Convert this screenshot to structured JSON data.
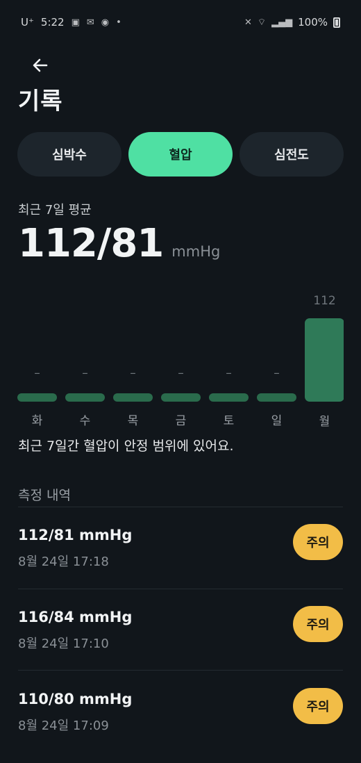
{
  "status_bar": {
    "carrier": "U⁺",
    "time": "5:22",
    "battery": "100%"
  },
  "header": {
    "title": "기록"
  },
  "tabs": [
    {
      "label": "심박수",
      "active": false
    },
    {
      "label": "혈압",
      "active": true
    },
    {
      "label": "심전도",
      "active": false
    }
  ],
  "average": {
    "label": "최근 7일 평균",
    "value": "112/81",
    "unit": "mmHg"
  },
  "chart_data": {
    "type": "bar",
    "categories": [
      "화",
      "수",
      "목",
      "금",
      "토",
      "일",
      "월"
    ],
    "values": [
      null,
      null,
      null,
      null,
      null,
      null,
      112
    ],
    "data_labels": [
      "–",
      "–",
      "–",
      "–",
      "–",
      "–",
      "112"
    ],
    "colors": {
      "bar": "#2f7a58",
      "placeholder": "#2a6b4c",
      "label": "#6f767c"
    }
  },
  "summary": "최근 7일간 혈압이 안정 범위에 있어요.",
  "history": {
    "title": "측정 내역",
    "items": [
      {
        "value": "112/81 mmHg",
        "time": "8월 24일 17:18",
        "status": "주의"
      },
      {
        "value": "116/84 mmHg",
        "time": "8월 24일 17:10",
        "status": "주의"
      },
      {
        "value": "110/80 mmHg",
        "time": "8월 24일 17:09",
        "status": "주의"
      }
    ]
  },
  "colors": {
    "background": "#11161b",
    "accent": "#4fe0a3",
    "warning": "#f2bd47"
  }
}
